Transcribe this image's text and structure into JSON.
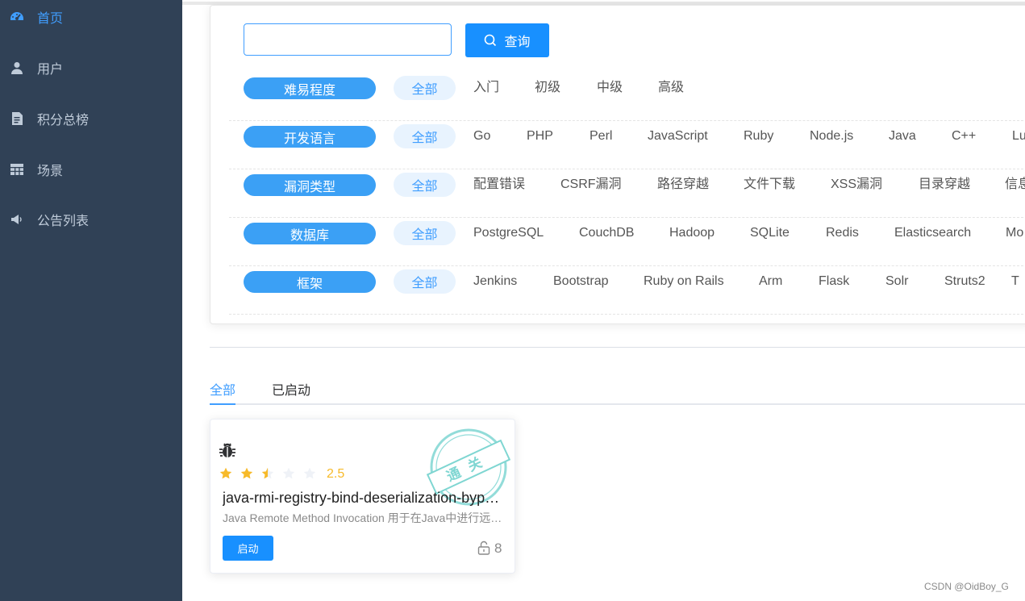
{
  "sidebar": {
    "items": [
      {
        "label": "首页",
        "icon": "dashboard-icon",
        "active": true
      },
      {
        "label": "用户",
        "icon": "user-icon",
        "active": false
      },
      {
        "label": "积分总榜",
        "icon": "document-icon",
        "active": false
      },
      {
        "label": "场景",
        "icon": "table-icon",
        "active": false
      },
      {
        "label": "公告列表",
        "icon": "megaphone-icon",
        "active": false
      }
    ]
  },
  "search": {
    "value": "",
    "button_label": "查询"
  },
  "filters": [
    {
      "label": "难易程度",
      "all": "全部",
      "options": [
        "入门",
        "初级",
        "中级",
        "高级"
      ]
    },
    {
      "label": "开发语言",
      "all": "全部",
      "options": [
        "Go",
        "PHP",
        "Perl",
        "JavaScript",
        "Ruby",
        "Node.js",
        "Java",
        "C++",
        "Lu"
      ]
    },
    {
      "label": "漏洞类型",
      "all": "全部",
      "options": [
        "配置错误",
        "CSRF漏洞",
        "路径穿越",
        "文件下载",
        "XSS漏洞",
        "目录穿越",
        "信息"
      ]
    },
    {
      "label": "数据库",
      "all": "全部",
      "options": [
        "PostgreSQL",
        "CouchDB",
        "Hadoop",
        "SQLite",
        "Redis",
        "Elasticsearch",
        "Mo"
      ]
    },
    {
      "label": "框架",
      "all": "全部",
      "options": [
        "Jenkins",
        "Bootstrap",
        "Ruby on Rails",
        "Arm",
        "Flask",
        "Solr",
        "Struts2",
        "T"
      ]
    }
  ],
  "tabs": [
    {
      "label": "全部",
      "active": true
    },
    {
      "label": "已启动",
      "active": false
    }
  ],
  "card": {
    "icon": "bug-icon",
    "rating": "2.5",
    "rating_value": 2.5,
    "rating_max": 5,
    "title": "java-rmi-registry-bind-deserialization-bypass",
    "description": "Java Remote Method Invocation 用于在Java中进行远程调用",
    "start_label": "启动",
    "count": "8",
    "stamp_text": "通关"
  },
  "watermark": "CSDN @OidBoy_G",
  "colors": {
    "sidebar_bg": "#304156",
    "primary": "#1890ff",
    "pill": "#3ba0f5",
    "star": "#f7ba2a"
  }
}
